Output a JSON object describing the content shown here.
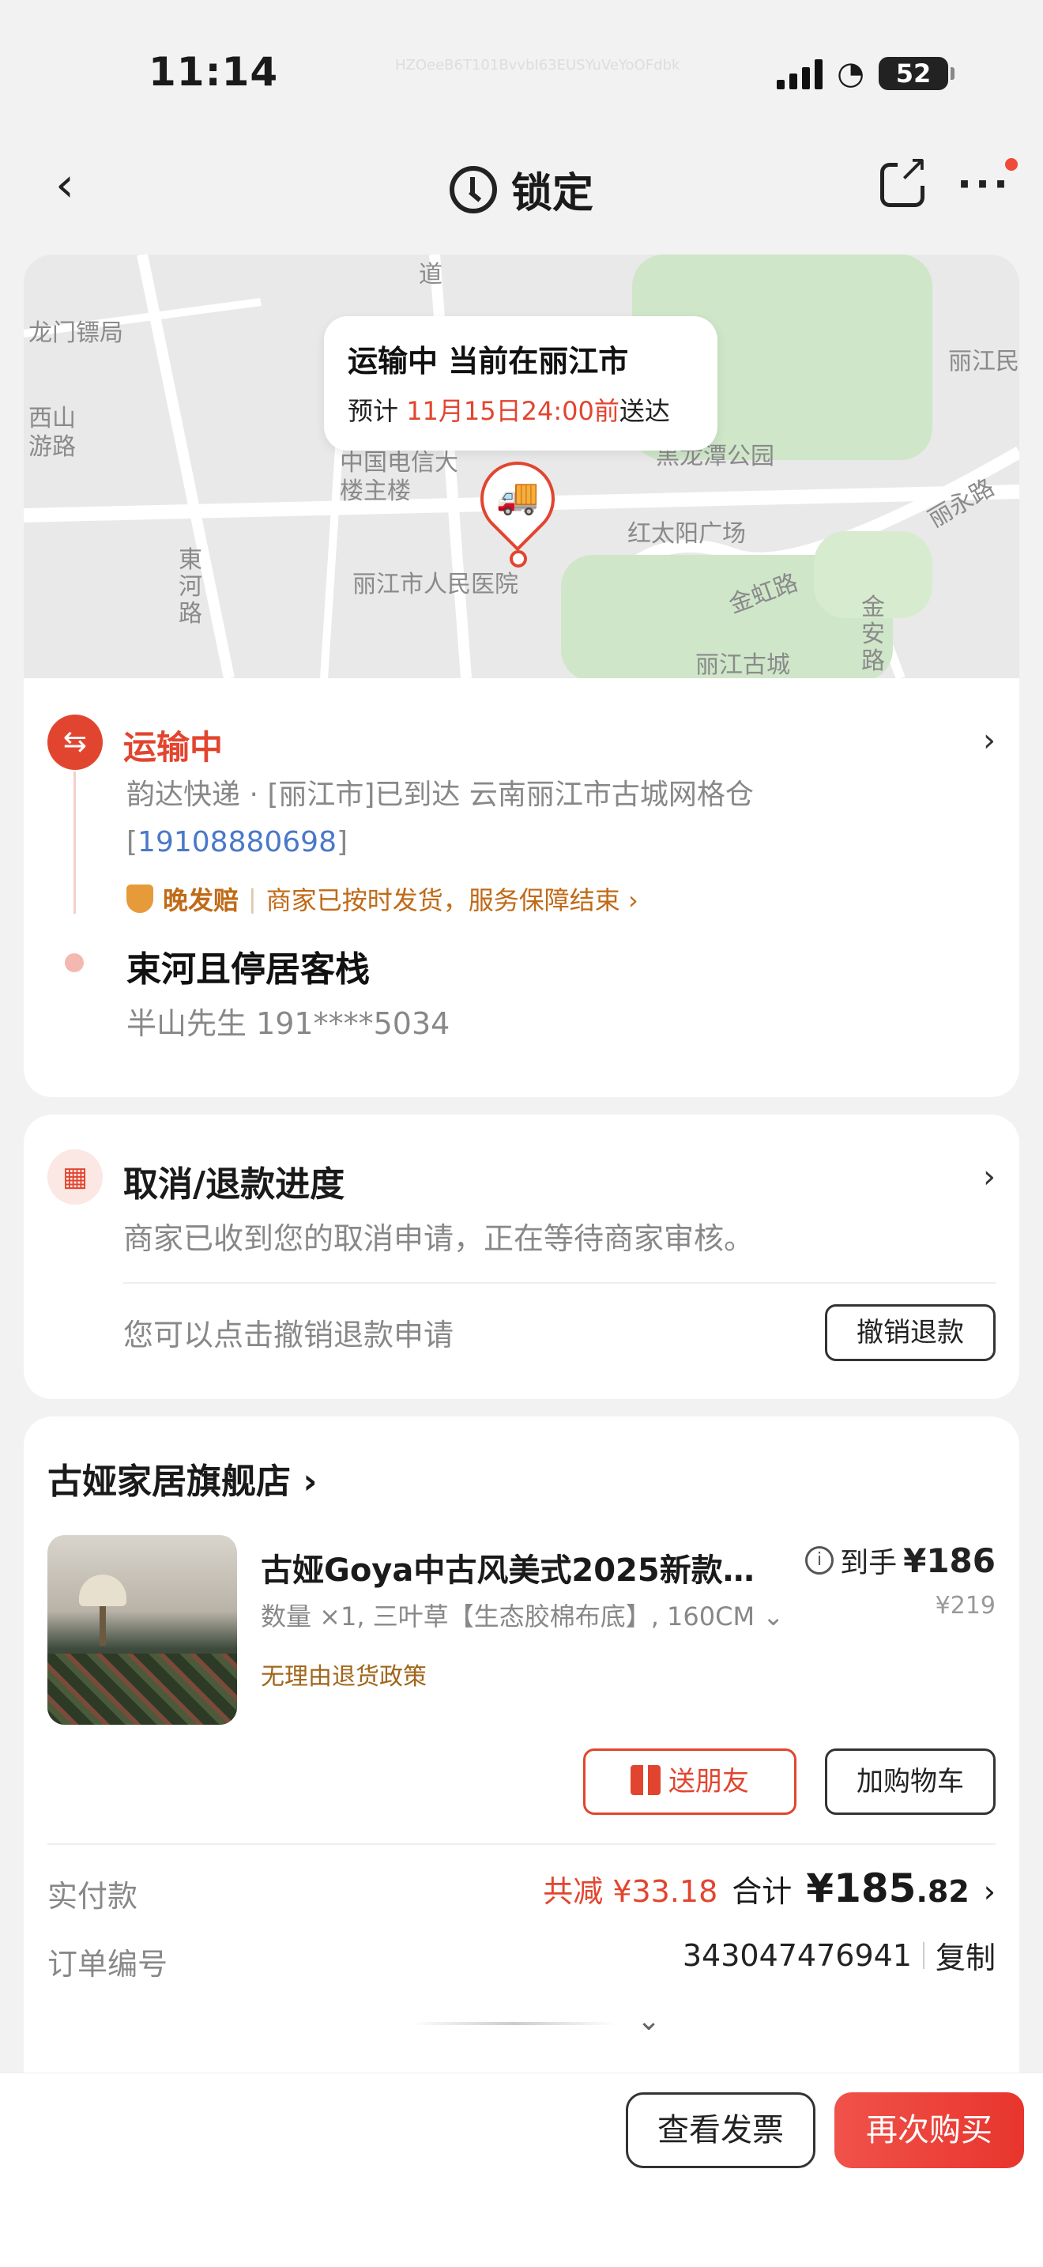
{
  "status_bar": {
    "time": "11:14",
    "watermark": "HZOeeB6T101BvvbI63EUSYuVeYoOFdbk",
    "battery": "52"
  },
  "nav": {
    "title": "锁定"
  },
  "map": {
    "labels": [
      "道",
      "龙门镖局",
      "西山游路",
      "中国电信大楼主楼",
      "東河路",
      "丽江市人民医院",
      "黑龙潭公园",
      "红太阳广场",
      "金虹路",
      "金安路",
      "丽江古城",
      "丽永路",
      "丽江民"
    ],
    "bubble_title": "运输中 当前在丽江市",
    "bubble_prefix": "预计",
    "bubble_time": "11月15日24:00前",
    "bubble_suffix": "送达"
  },
  "logistics": {
    "status": "运输中",
    "detail": "韵达快递 · [丽江市]已到达 云南丽江市古城网格仓",
    "phone": "19108880698",
    "guarantee_label": "晚发赔",
    "guarantee_text": "商家已按时发货，服务保障结束 ›",
    "address_name": "束河且停居客栈",
    "contact": "半山先生  191****5034"
  },
  "refund": {
    "title": "取消/退款进度",
    "desc": "商家已收到您的取消申请，正在等待商家审核。",
    "hint": "您可以点击撤销退款申请",
    "button": "撤销退款"
  },
  "order": {
    "store": "古娅家居旗舰店 ›",
    "product_title": "古娅Goya中古风美式2025新款…",
    "spec": "数量 ×1, 三叶草【生态胶棉布底】, 160CM",
    "policy": "无理由退货政策",
    "price_label": "到手",
    "price": "¥186",
    "original_price": "¥219",
    "gift_button": "送朋友",
    "cart_button": "加购物车",
    "paid_label": "实付款",
    "savings": "共减 ¥33.18",
    "total_label": "合计",
    "total_int": "¥185",
    "total_dec": ".82",
    "order_label": "订单编号",
    "order_no": "343047476941",
    "copy": "复制"
  },
  "bottom": {
    "invoice": "查看发票",
    "rebuy": "再次购买"
  },
  "colors": {
    "accent": "#e2452f",
    "link": "#4a78c9",
    "warn": "#c06a17"
  }
}
